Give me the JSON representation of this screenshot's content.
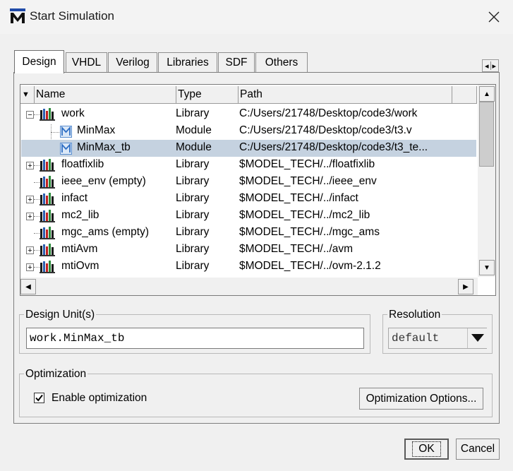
{
  "window": {
    "title": "Start Simulation"
  },
  "tabs": [
    "Design",
    "VHDL",
    "Verilog",
    "Libraries",
    "SDF",
    "Others"
  ],
  "tree": {
    "columns": [
      "Name",
      "Type",
      "Path"
    ],
    "rows": [
      {
        "name": "work",
        "type": "Library",
        "path": "C:/Users/21748/Desktop/code3/work",
        "kind": "library",
        "expander": "−"
      },
      {
        "name": "MinMax",
        "type": "Module",
        "path": "C:/Users/21748/Desktop/code3/t3.v",
        "kind": "module",
        "expander": ""
      },
      {
        "name": "MinMax_tb",
        "type": "Module",
        "path": "C:/Users/21748/Desktop/code3/t3_te...",
        "kind": "module",
        "expander": ""
      },
      {
        "name": "floatfixlib",
        "type": "Library",
        "path": "$MODEL_TECH/../floatfixlib",
        "kind": "library",
        "expander": "+"
      },
      {
        "name": "ieee_env  (empty)",
        "type": "Library",
        "path": "$MODEL_TECH/../ieee_env",
        "kind": "library",
        "expander": ""
      },
      {
        "name": "infact",
        "type": "Library",
        "path": "$MODEL_TECH/../infact",
        "kind": "library",
        "expander": "+"
      },
      {
        "name": "mc2_lib",
        "type": "Library",
        "path": "$MODEL_TECH/../mc2_lib",
        "kind": "library",
        "expander": "+"
      },
      {
        "name": "mgc_ams  (empty)",
        "type": "Library",
        "path": "$MODEL_TECH/../mgc_ams",
        "kind": "library",
        "expander": ""
      },
      {
        "name": "mtiAvm",
        "type": "Library",
        "path": "$MODEL_TECH/../avm",
        "kind": "library",
        "expander": "+"
      },
      {
        "name": "mtiOvm",
        "type": "Library",
        "path": "$MODEL_TECH/../ovm-2.1.2",
        "kind": "library",
        "expander": "+"
      }
    ]
  },
  "design_unit": {
    "label": "Design Unit(s)",
    "value": "work.MinMax_tb"
  },
  "resolution": {
    "label": "Resolution",
    "value": "default"
  },
  "optimization": {
    "label": "Optimization",
    "checkbox_label": "Enable optimization",
    "checked": true,
    "options_button": "Optimization Options..."
  },
  "buttons": {
    "ok": "OK",
    "cancel": "Cancel"
  },
  "colors": {
    "selected_row": "#c5d2e0",
    "app_icon_blue": "#1f4aa8"
  }
}
